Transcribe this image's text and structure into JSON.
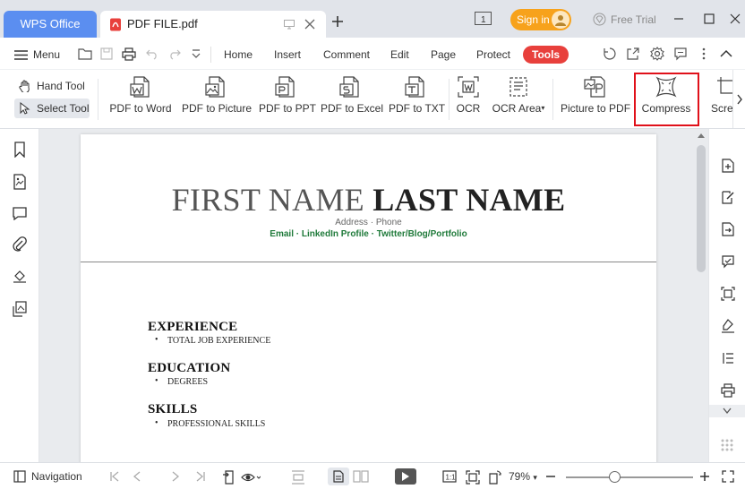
{
  "titlebar": {
    "app_tab": "WPS Office",
    "doc_tab": "PDF FILE.pdf",
    "signin": "Sign in",
    "free_trial": "Free Trial",
    "page_badge": "1"
  },
  "menubar": {
    "menu_label": "Menu",
    "tabs": [
      "Home",
      "Insert",
      "Comment",
      "Edit",
      "Page",
      "Protect",
      "Tools"
    ],
    "active_tab": "Tools"
  },
  "toolbar": {
    "hand_tool": "Hand Tool",
    "select_tool": "Select Tool",
    "tools": [
      {
        "label": "PDF to Word",
        "icon": "pdf-to-word-icon"
      },
      {
        "label": "PDF to Picture",
        "icon": "pdf-to-picture-icon"
      },
      {
        "label": "PDF to PPT",
        "icon": "pdf-to-ppt-icon"
      },
      {
        "label": "PDF to Excel",
        "icon": "pdf-to-excel-icon"
      },
      {
        "label": "PDF to TXT",
        "icon": "pdf-to-txt-icon"
      },
      {
        "label": "OCR",
        "icon": "ocr-icon"
      },
      {
        "label": "OCR Area",
        "icon": "ocr-area-icon"
      },
      {
        "label": "Picture to PDF",
        "icon": "picture-to-pdf-icon"
      },
      {
        "label": "Compress",
        "icon": "compress-icon"
      },
      {
        "label": "Scree",
        "icon": "screenshot-icon"
      }
    ]
  },
  "document": {
    "first_name": "FIRST NAME",
    "last_name": "LAST NAME",
    "address_line": "Address · Phone",
    "links_line": "Email · LinkedIn Profile · Twitter/Blog/Portfolio",
    "sections": [
      {
        "heading": "EXPERIENCE",
        "item": "TOTAL JOB EXPERIENCE"
      },
      {
        "heading": "EDUCATION",
        "item": "DEGREES"
      },
      {
        "heading": "SKILLS",
        "item": "PROFESSIONAL SKILLS"
      }
    ]
  },
  "statusbar": {
    "navigation": "Navigation",
    "zoom": "79%"
  },
  "colors": {
    "accent_blue": "#5b8ef0",
    "tools_red": "#e8403c",
    "signin_orange": "#f7a21b",
    "highlight_box": "#e0111a",
    "link_green": "#1f7a3a"
  }
}
